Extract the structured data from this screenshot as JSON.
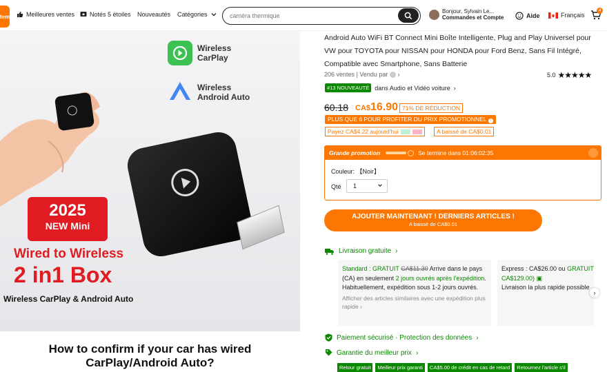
{
  "header": {
    "logo_text": "tem",
    "nav": [
      {
        "label": "Meilleures ventes",
        "icon": "thumbs-up-icon"
      },
      {
        "label": "Notés 5 étoiles",
        "icon": "star-badge-icon"
      },
      {
        "label": "Nouveautés",
        "icon": ""
      },
      {
        "label": "Catégories",
        "icon": "chevron-down-icon"
      }
    ],
    "search_value": "caméra thermique",
    "account_greeting": "Bonjour, Sylvain Le...",
    "account_label": "Commandes et Compte",
    "help_label": "Aide",
    "language_label": "Français",
    "cart_count": "4"
  },
  "hero": {
    "badge_wireless_carplay": "Wireless\nCarPlay",
    "badge_android_auto": "Wireless\nAndroid Auto",
    "year_badge_line1": "2025",
    "year_badge_line2": "NEW Mini",
    "headline1": "Wired to Wireless",
    "headline2": "2 in1 Box",
    "subline": "Wireless CarPlay & Android Auto",
    "question_line1": "How to confirm if your car has wired",
    "question_line2": "CarPlay/Android Auto?"
  },
  "product": {
    "title": "Android Auto WiFi BT Connect Mini Boîte Intelligente, Plug and Play Universel pour VW pour TOYOTA pour NISSAN pour HONDA pour Ford Benz, Sans Fil Intégré, Compatible avec Smartphone, Sans Batterie",
    "sales_text": "206 ventes | Vendu par",
    "rating": "5.0",
    "rank_badge": "#13 NOUVEAUTÉ",
    "rank_text": "dans Audio et Vidéo voiture",
    "old_price": "60.18",
    "new_price_prefix": "CA$",
    "new_price": "16.90",
    "discount": "71% DE RÉDUCTION",
    "promo_note": "PLUS QUE 6 POUR PROFITER DU PRIX PROMOTIONNEL",
    "pay_later": "Payez CA$4.22 aujourd'hui",
    "price_drop": "A baissé de CA$0.01"
  },
  "promo_box": {
    "title": "Grande promotion",
    "ends_text": "Se termine dans 01:06:02:35",
    "color_label": "Couleur:",
    "color_value": "【Noir】",
    "qty_label": "Qté",
    "qty_value": "1"
  },
  "cta": {
    "label": "AJOUTER MAINTENANT ! DERNIERS ARTICLES !",
    "sub": "A baissé de CA$0.01"
  },
  "shipping": {
    "title": "Livraison gratuite",
    "standard_label": "Standard :",
    "standard_free": "GRATUIT",
    "standard_old": "CA$11.30",
    "standard_arrives": "Arrive dans le pays (CA) en seulement",
    "standard_days": "2 jours ouvrés après l'expédition",
    "standard_after": ". Habituellement, expédition sous 1-2 jours ouvrés.",
    "similar": "Afficher des articles similaires avec une expédition plus rapide",
    "express_label": "Express : CA$26.00 ou",
    "express_free": "GRATUIT (",
    "express_min": "CA$129.00)",
    "express_note": "Livraison la plus rapide possible"
  },
  "trust": {
    "secure": "Paiement sécurisé · Protection des données",
    "guarantee": "Garantie du meilleur prix",
    "tags": [
      "Retour gratuit",
      "Meilleur prix garanti",
      "CA$5.00 de crédit en cas de retard",
      "Retournez l'article s'il"
    ]
  },
  "colors": {
    "brand": "#fb7701",
    "green": "#0a8800"
  }
}
